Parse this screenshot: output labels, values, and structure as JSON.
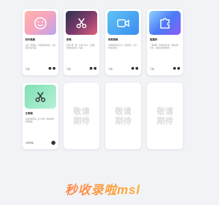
{
  "cards": [
    {
      "title": "快乐美颜",
      "desc": "只需一秒换脸，AI智能美颜高清，让你拥有更多乐趣。",
      "download": "下载：",
      "icon": "smile-face-icon"
    },
    {
      "title": "剪映",
      "desc": "剪辑只需一键，高清无水印，让视频制作更加简单、有趣。",
      "download": "下载：",
      "icon": "scissors-icon"
    },
    {
      "title": "快剪视频",
      "desc": "免费视频剪辑工具，录屏剪辑，让创作变得简单。",
      "download": "下载：",
      "icon": "video-camera-icon"
    },
    {
      "title": "抠图侠",
      "desc": "一键抠图，智能识别主体，快速去除背景，让图片处理更轻松。",
      "download": "下载：",
      "icon": "puzzle-icon"
    },
    {
      "title": "云剪辑",
      "desc": "在线云端剪辑，多人协作，随时随地剪辑视频。",
      "download": "立即体验",
      "icon": "scissors-icon"
    }
  ],
  "placeholders": [
    "敬请期待",
    "敬请期待",
    "敬请期待"
  ],
  "footer": "秒收录啦msl"
}
